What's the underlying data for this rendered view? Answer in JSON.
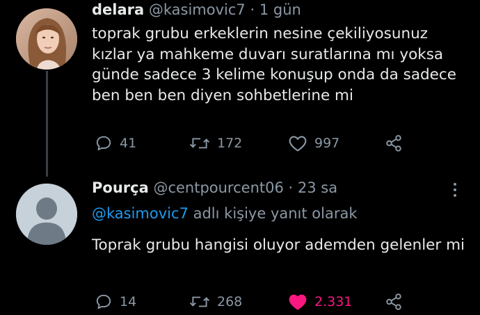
{
  "tweet": {
    "display_name": "delara",
    "handle": "@kasimovic7",
    "separator": "·",
    "time": "1 gün",
    "text": "toprak grubu erkeklerin nesine çekiliyosunuz kızlar ya mahkeme duvarı suratlarına mı yoksa günde sadece 3 kelime konuşup onda da sadece ben ben ben diyen sohbetlerine mi",
    "reply_count": "41",
    "retweet_count": "172",
    "like_count": "997",
    "liked": false
  },
  "reply": {
    "display_name": "Pourça",
    "handle": "@centpourcent06",
    "separator": "·",
    "time": "23 sa",
    "replying_to_handle": "@kasimovic7",
    "replying_to_suffix": "adlı kişiye yanıt olarak",
    "text": "Toprak grubu hangisi oluyor ademden gelenler mi",
    "reply_count": "14",
    "retweet_count": "268",
    "like_count": "2.331",
    "liked": true
  },
  "icons": {
    "reply": "comment-bubble-icon",
    "retweet": "retweet-arrows-icon",
    "like": "heart-icon",
    "share": "share-icon",
    "more": "more-vertical-icon",
    "default_avatar": "default-user-silhouette"
  },
  "colors": {
    "background": "#000000",
    "text_primary": "#e7e9ea",
    "text_secondary": "#8b98a5",
    "link": "#1d9bf0",
    "like_active": "#f91880",
    "thread_line": "#3a3f44"
  }
}
